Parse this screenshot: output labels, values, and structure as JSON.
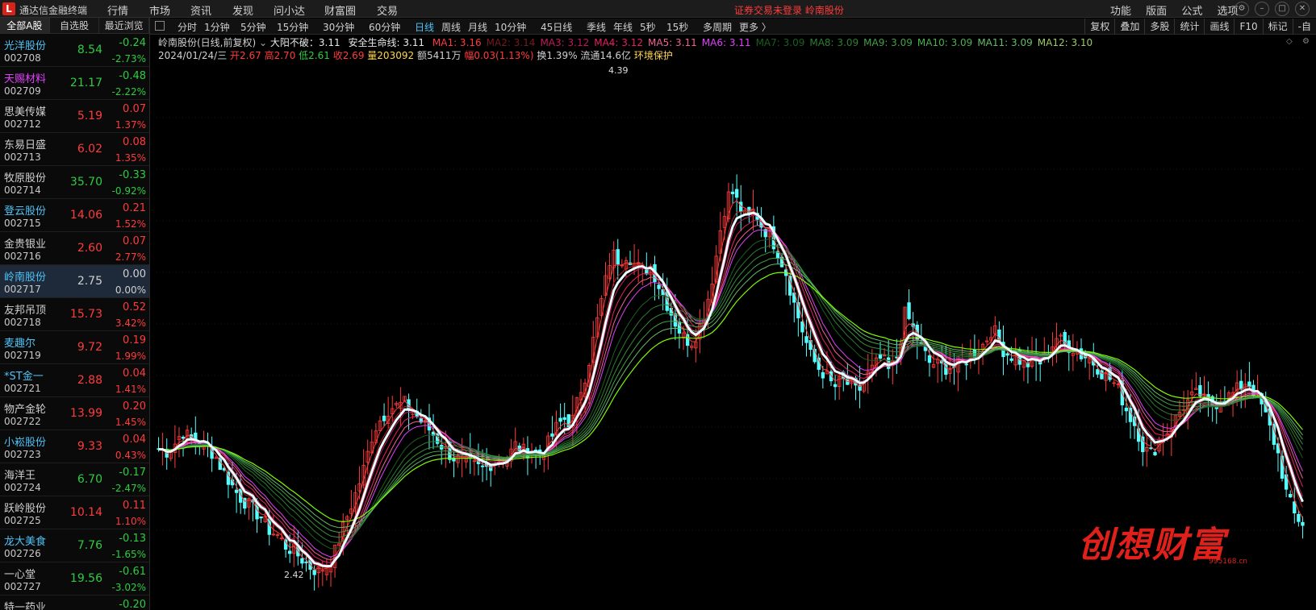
{
  "app": {
    "logo_glyph": "L",
    "title": "通达信金融终端",
    "menu": [
      "行情",
      "市场",
      "资讯",
      "发现",
      "问小达",
      "财富圈",
      "交易"
    ],
    "warning": "证券交易未登录   岭南股份",
    "right_menu": [
      "功能",
      "版面",
      "公式",
      "选项"
    ],
    "win_buttons": [
      "⚙",
      "–",
      "□",
      "✕"
    ]
  },
  "left_panel": {
    "tabs": [
      "全部A股",
      "自选股",
      "最近浏览"
    ],
    "stocks": [
      {
        "name": "光洋股份",
        "code": "002708",
        "price": "8.54",
        "change": "-0.24",
        "pct": "-2.73%",
        "name_color": "#4fc3f7",
        "trend": "down"
      },
      {
        "name": "天赐材料",
        "code": "002709",
        "price": "21.17",
        "change": "-0.48",
        "pct": "-2.22%",
        "name_color": "#e040fb",
        "trend": "down"
      },
      {
        "name": "思美传媒",
        "code": "002712",
        "price": "5.19",
        "change": "0.07",
        "pct": "1.37%",
        "name_color": "#d0d0d0",
        "trend": "up"
      },
      {
        "name": "东易日盛",
        "code": "002713",
        "price": "6.02",
        "change": "0.08",
        "pct": "1.35%",
        "name_color": "#d0d0d0",
        "trend": "up"
      },
      {
        "name": "牧原股份",
        "code": "002714",
        "price": "35.70",
        "change": "-0.33",
        "pct": "-0.92%",
        "name_color": "#d0d0d0",
        "trend": "down"
      },
      {
        "name": "登云股份",
        "code": "002715",
        "price": "14.06",
        "change": "0.21",
        "pct": "1.52%",
        "name_color": "#4fc3f7",
        "trend": "up"
      },
      {
        "name": "金贵银业",
        "code": "002716",
        "price": "2.60",
        "change": "0.07",
        "pct": "2.77%",
        "name_color": "#d0d0d0",
        "trend": "up"
      },
      {
        "name": "岭南股份",
        "code": "002717",
        "price": "2.75",
        "change": "0.00",
        "pct": "0.00%",
        "name_color": "#4fc3f7",
        "trend": "flat",
        "selected": true
      },
      {
        "name": "友邦吊顶",
        "code": "002718",
        "price": "15.73",
        "change": "0.52",
        "pct": "3.42%",
        "name_color": "#d0d0d0",
        "trend": "up"
      },
      {
        "name": "麦趣尔",
        "code": "002719",
        "price": "9.72",
        "change": "0.19",
        "pct": "1.99%",
        "name_color": "#4fc3f7",
        "trend": "up"
      },
      {
        "name": "*ST金一",
        "code": "002721",
        "price": "2.88",
        "change": "0.04",
        "pct": "1.41%",
        "name_color": "#4fc3f7",
        "trend": "up"
      },
      {
        "name": "物产金轮",
        "code": "002722",
        "price": "13.99",
        "change": "0.20",
        "pct": "1.45%",
        "name_color": "#d0d0d0",
        "trend": "up"
      },
      {
        "name": "小崧股份",
        "code": "002723",
        "price": "9.33",
        "change": "0.04",
        "pct": "0.43%",
        "name_color": "#4fc3f7",
        "trend": "up"
      },
      {
        "name": "海洋王",
        "code": "002724",
        "price": "6.70",
        "change": "-0.17",
        "pct": "-2.47%",
        "name_color": "#d0d0d0",
        "trend": "down"
      },
      {
        "name": "跃岭股份",
        "code": "002725",
        "price": "10.14",
        "change": "0.11",
        "pct": "1.10%",
        "name_color": "#d0d0d0",
        "trend": "up"
      },
      {
        "name": "龙大美食",
        "code": "002726",
        "price": "7.76",
        "change": "-0.13",
        "pct": "-1.65%",
        "name_color": "#4fc3f7",
        "trend": "down"
      },
      {
        "name": "一心堂",
        "code": "002727",
        "price": "19.56",
        "change": "-0.61",
        "pct": "-3.02%",
        "name_color": "#d0d0d0",
        "trend": "down"
      },
      {
        "name": "特一药业",
        "code": "",
        "price": "",
        "change": "-0.20",
        "pct": "",
        "name_color": "#d0d0d0",
        "trend": "down"
      }
    ]
  },
  "toolbar": {
    "periods": [
      "分时",
      "1分钟",
      "5分钟",
      "15分钟",
      "30分钟",
      "60分钟",
      "日线",
      "周线",
      "月线",
      "10分钟",
      "45日线",
      "季线",
      "年线",
      "5秒",
      "15秒",
      "多周期",
      "更多 〉"
    ],
    "active_period": "日线",
    "right_tools": [
      "复权",
      "叠加",
      "多股",
      "统计",
      "画线",
      "F10",
      "标记",
      "-自"
    ]
  },
  "chart_info": {
    "title": "岭南股份(日线,前复权)",
    "indicator": "大阳不破：3.11",
    "safety_line": "安全生命线: 3.11",
    "mas": [
      {
        "label": "MA1: 3.16",
        "color": "#ff3b3b"
      },
      {
        "label": "MA2: 3.14",
        "color": "#7a1a1a"
      },
      {
        "label": "MA3: 3.12",
        "color": "#c2185b"
      },
      {
        "label": "MA4: 3.12",
        "color": "#e91e63"
      },
      {
        "label": "MA5: 3.11",
        "color": "#f06292"
      },
      {
        "label": "MA6: 3.11",
        "color": "#e040fb"
      },
      {
        "label": "MA7: 3.09",
        "color": "#1b5e20"
      },
      {
        "label": "MA8: 3.09",
        "color": "#2e7d32"
      },
      {
        "label": "MA9: 3.09",
        "color": "#43a047"
      },
      {
        "label": "MA10: 3.09",
        "color": "#4caf50"
      },
      {
        "label": "MA11: 3.09",
        "color": "#66bb6a"
      },
      {
        "label": "MA12: 3.10",
        "color": "#9ccc65"
      }
    ],
    "date": "2024/01/24/三",
    "open": "开2.67",
    "high": "高2.70",
    "low": "低2.61",
    "close": "收2.69",
    "volume": "量203092",
    "amount": "额5411万",
    "range": "幅0.03(1.13%)",
    "turnover": "换1.39%",
    "float_cap": "流通14.6亿",
    "env": "环境保护"
  },
  "chart_data": {
    "type": "candlestick",
    "series": "岭南股份 日线",
    "max_label": "4.39",
    "min_label": "2.42",
    "ylim": [
      2.38,
      4.48
    ],
    "closes": [
      2.98,
      2.97,
      3.0,
      3.05,
      3.02,
      3.01,
      2.99,
      2.96,
      2.9,
      2.85,
      2.8,
      2.77,
      2.74,
      2.71,
      2.66,
      2.64,
      2.6,
      2.58,
      2.55,
      2.52,
      2.5,
      2.52,
      2.56,
      2.65,
      2.74,
      2.82,
      2.92,
      3.05,
      3.1,
      3.14,
      3.15,
      3.16,
      3.13,
      3.09,
      3.06,
      3.02,
      2.98,
      2.95,
      2.93,
      2.92,
      2.91,
      2.9,
      2.93,
      2.94,
      2.95,
      3.0,
      2.97,
      2.98,
      2.96,
      3.0,
      3.06,
      3.1,
      3.08,
      3.2,
      3.3,
      3.45,
      3.6,
      3.75,
      3.72,
      3.75,
      3.7,
      3.68,
      3.7,
      3.62,
      3.55,
      3.48,
      3.42,
      3.4,
      3.45,
      3.55,
      3.7,
      3.9,
      4.0,
      3.94,
      3.88,
      3.92,
      3.85,
      3.82,
      3.75,
      3.67,
      3.55,
      3.45,
      3.35,
      3.3,
      3.27,
      3.22,
      3.25,
      3.23,
      3.2,
      3.26,
      3.3,
      3.34,
      3.28,
      3.35,
      3.52,
      3.45,
      3.38,
      3.32,
      3.31,
      3.3,
      3.3,
      3.32,
      3.34,
      3.36,
      3.4,
      3.46,
      3.38,
      3.35,
      3.34,
      3.31,
      3.32,
      3.32,
      3.36,
      3.42,
      3.39,
      3.38,
      3.35,
      3.34,
      3.31,
      3.27,
      3.25,
      3.2,
      3.12,
      3.07,
      2.98,
      2.96,
      3.02,
      3.05,
      3.1,
      3.15,
      3.18,
      3.2,
      3.15,
      3.16,
      3.18,
      3.19,
      3.22,
      3.25,
      3.2,
      3.14,
      3.05,
      2.95,
      2.8,
      2.72,
      2.69
    ]
  }
}
